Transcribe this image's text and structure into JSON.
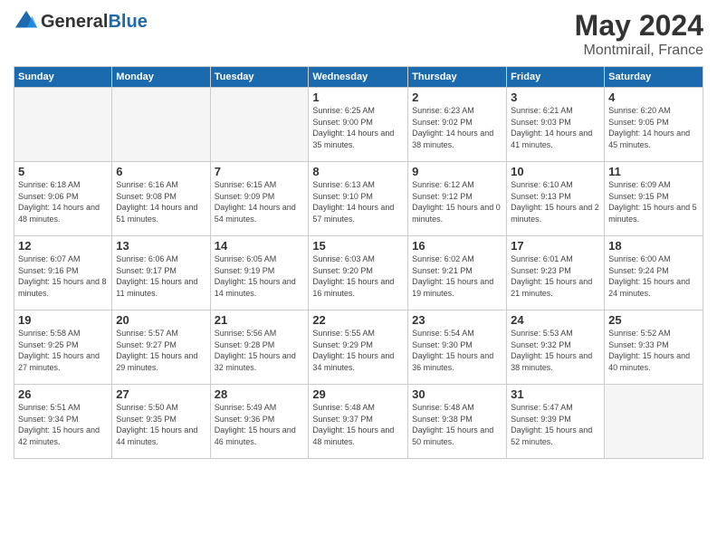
{
  "header": {
    "logo_line1": "General",
    "logo_line2": "Blue",
    "month": "May 2024",
    "location": "Montmirail, France"
  },
  "weekdays": [
    "Sunday",
    "Monday",
    "Tuesday",
    "Wednesday",
    "Thursday",
    "Friday",
    "Saturday"
  ],
  "weeks": [
    [
      {
        "day": "",
        "info": "",
        "empty": true
      },
      {
        "day": "",
        "info": "",
        "empty": true
      },
      {
        "day": "",
        "info": "",
        "empty": true
      },
      {
        "day": "1",
        "info": "Sunrise: 6:25 AM\nSunset: 9:00 PM\nDaylight: 14 hours\nand 35 minutes.",
        "empty": false
      },
      {
        "day": "2",
        "info": "Sunrise: 6:23 AM\nSunset: 9:02 PM\nDaylight: 14 hours\nand 38 minutes.",
        "empty": false
      },
      {
        "day": "3",
        "info": "Sunrise: 6:21 AM\nSunset: 9:03 PM\nDaylight: 14 hours\nand 41 minutes.",
        "empty": false
      },
      {
        "day": "4",
        "info": "Sunrise: 6:20 AM\nSunset: 9:05 PM\nDaylight: 14 hours\nand 45 minutes.",
        "empty": false
      }
    ],
    [
      {
        "day": "5",
        "info": "Sunrise: 6:18 AM\nSunset: 9:06 PM\nDaylight: 14 hours\nand 48 minutes.",
        "empty": false
      },
      {
        "day": "6",
        "info": "Sunrise: 6:16 AM\nSunset: 9:08 PM\nDaylight: 14 hours\nand 51 minutes.",
        "empty": false
      },
      {
        "day": "7",
        "info": "Sunrise: 6:15 AM\nSunset: 9:09 PM\nDaylight: 14 hours\nand 54 minutes.",
        "empty": false
      },
      {
        "day": "8",
        "info": "Sunrise: 6:13 AM\nSunset: 9:10 PM\nDaylight: 14 hours\nand 57 minutes.",
        "empty": false
      },
      {
        "day": "9",
        "info": "Sunrise: 6:12 AM\nSunset: 9:12 PM\nDaylight: 15 hours\nand 0 minutes.",
        "empty": false
      },
      {
        "day": "10",
        "info": "Sunrise: 6:10 AM\nSunset: 9:13 PM\nDaylight: 15 hours\nand 2 minutes.",
        "empty": false
      },
      {
        "day": "11",
        "info": "Sunrise: 6:09 AM\nSunset: 9:15 PM\nDaylight: 15 hours\nand 5 minutes.",
        "empty": false
      }
    ],
    [
      {
        "day": "12",
        "info": "Sunrise: 6:07 AM\nSunset: 9:16 PM\nDaylight: 15 hours\nand 8 minutes.",
        "empty": false
      },
      {
        "day": "13",
        "info": "Sunrise: 6:06 AM\nSunset: 9:17 PM\nDaylight: 15 hours\nand 11 minutes.",
        "empty": false
      },
      {
        "day": "14",
        "info": "Sunrise: 6:05 AM\nSunset: 9:19 PM\nDaylight: 15 hours\nand 14 minutes.",
        "empty": false
      },
      {
        "day": "15",
        "info": "Sunrise: 6:03 AM\nSunset: 9:20 PM\nDaylight: 15 hours\nand 16 minutes.",
        "empty": false
      },
      {
        "day": "16",
        "info": "Sunrise: 6:02 AM\nSunset: 9:21 PM\nDaylight: 15 hours\nand 19 minutes.",
        "empty": false
      },
      {
        "day": "17",
        "info": "Sunrise: 6:01 AM\nSunset: 9:23 PM\nDaylight: 15 hours\nand 21 minutes.",
        "empty": false
      },
      {
        "day": "18",
        "info": "Sunrise: 6:00 AM\nSunset: 9:24 PM\nDaylight: 15 hours\nand 24 minutes.",
        "empty": false
      }
    ],
    [
      {
        "day": "19",
        "info": "Sunrise: 5:58 AM\nSunset: 9:25 PM\nDaylight: 15 hours\nand 27 minutes.",
        "empty": false
      },
      {
        "day": "20",
        "info": "Sunrise: 5:57 AM\nSunset: 9:27 PM\nDaylight: 15 hours\nand 29 minutes.",
        "empty": false
      },
      {
        "day": "21",
        "info": "Sunrise: 5:56 AM\nSunset: 9:28 PM\nDaylight: 15 hours\nand 32 minutes.",
        "empty": false
      },
      {
        "day": "22",
        "info": "Sunrise: 5:55 AM\nSunset: 9:29 PM\nDaylight: 15 hours\nand 34 minutes.",
        "empty": false
      },
      {
        "day": "23",
        "info": "Sunrise: 5:54 AM\nSunset: 9:30 PM\nDaylight: 15 hours\nand 36 minutes.",
        "empty": false
      },
      {
        "day": "24",
        "info": "Sunrise: 5:53 AM\nSunset: 9:32 PM\nDaylight: 15 hours\nand 38 minutes.",
        "empty": false
      },
      {
        "day": "25",
        "info": "Sunrise: 5:52 AM\nSunset: 9:33 PM\nDaylight: 15 hours\nand 40 minutes.",
        "empty": false
      }
    ],
    [
      {
        "day": "26",
        "info": "Sunrise: 5:51 AM\nSunset: 9:34 PM\nDaylight: 15 hours\nand 42 minutes.",
        "empty": false
      },
      {
        "day": "27",
        "info": "Sunrise: 5:50 AM\nSunset: 9:35 PM\nDaylight: 15 hours\nand 44 minutes.",
        "empty": false
      },
      {
        "day": "28",
        "info": "Sunrise: 5:49 AM\nSunset: 9:36 PM\nDaylight: 15 hours\nand 46 minutes.",
        "empty": false
      },
      {
        "day": "29",
        "info": "Sunrise: 5:48 AM\nSunset: 9:37 PM\nDaylight: 15 hours\nand 48 minutes.",
        "empty": false
      },
      {
        "day": "30",
        "info": "Sunrise: 5:48 AM\nSunset: 9:38 PM\nDaylight: 15 hours\nand 50 minutes.",
        "empty": false
      },
      {
        "day": "31",
        "info": "Sunrise: 5:47 AM\nSunset: 9:39 PM\nDaylight: 15 hours\nand 52 minutes.",
        "empty": false
      },
      {
        "day": "",
        "info": "",
        "empty": true
      }
    ]
  ]
}
